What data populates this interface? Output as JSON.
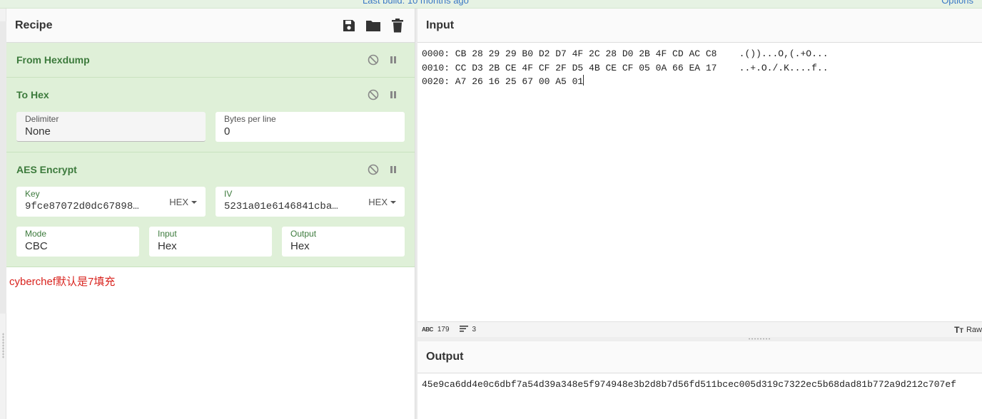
{
  "topbar": {
    "built_text": "Last build: 10 months ago",
    "options_text": "Options"
  },
  "recipe": {
    "title": "Recipe",
    "actions": [
      {
        "name": "save-icon"
      },
      {
        "name": "folder-icon"
      },
      {
        "name": "trash-icon"
      }
    ],
    "operations": {
      "from_hexdump": {
        "title": "From Hexdump"
      },
      "to_hex": {
        "title": "To Hex",
        "delimiter_label": "Delimiter",
        "delimiter_value": "None",
        "bytes_label": "Bytes per line",
        "bytes_value": "0"
      },
      "aes_encrypt": {
        "title": "AES Encrypt",
        "key_label": "Key",
        "key_value": "9fce87072d0dc67898…",
        "key_format": "HEX",
        "iv_label": "IV",
        "iv_value": "5231a01e6146841cba…",
        "iv_format": "HEX",
        "mode_label": "Mode",
        "mode_value": "CBC",
        "input_label": "Input",
        "input_value": "Hex",
        "output_label": "Output",
        "output_value": "Hex"
      }
    },
    "note": "cyberchef默认是7填充"
  },
  "input": {
    "title": "Input",
    "lines": [
      "0000: CB 28 29 29 B0 D2 D7 4F 2C 28 D0 2B 4F CD AC C8    .())...O,(.+O...",
      "0010: CC D3 2B CE 4F CF 2F D5 4B CE CF 05 0A 66 EA 17    ..+.O./.K....f..",
      "0020: A7 26 16 25 67 00 A5 01"
    ]
  },
  "status": {
    "abc_label": "ABC",
    "chars": "179",
    "lines": "3",
    "raw_label": "Raw"
  },
  "output": {
    "title": "Output",
    "value": "45e9ca6dd4e0c6dbf7a54d39a348e5f974948e3b2d8b7d56fd511bcec005d319c7322ec5b68dad81b772a9d212c707ef"
  },
  "colors": {
    "op_bg": "#dff0d8",
    "op_title": "#3c7a3c",
    "note": "#d9231e",
    "link": "#3b78c5"
  }
}
